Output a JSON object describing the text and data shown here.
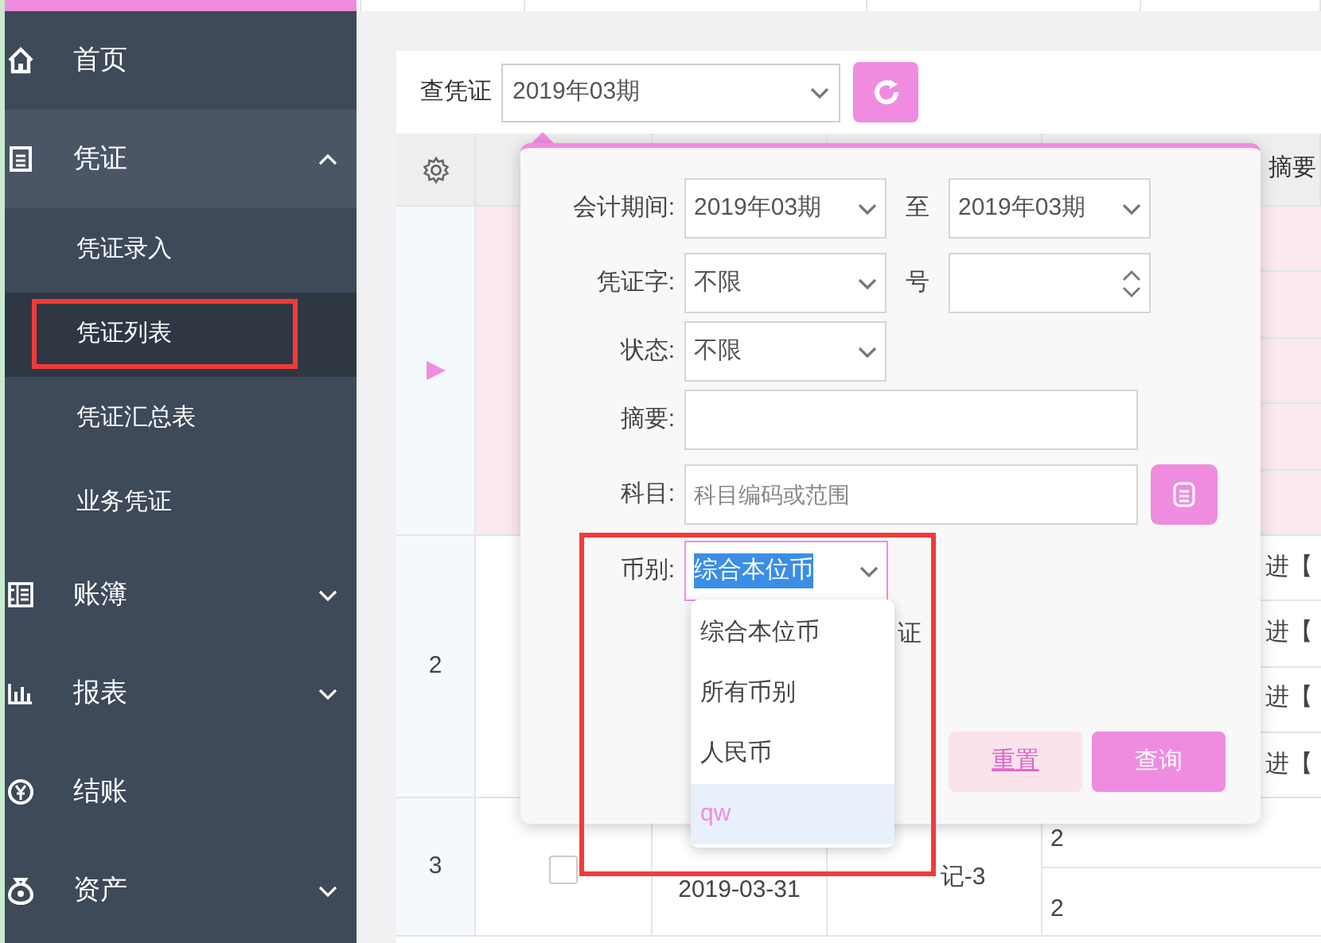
{
  "sidebar": {
    "items": [
      {
        "label": "首页",
        "kind": "link"
      },
      {
        "label": "凭证",
        "kind": "group",
        "expanded": true,
        "children": [
          {
            "label": "凭证录入",
            "selected": false
          },
          {
            "label": "凭证列表",
            "selected": true
          },
          {
            "label": "凭证汇总表",
            "selected": false
          },
          {
            "label": "业务凭证",
            "selected": false
          }
        ]
      },
      {
        "label": "账簿",
        "kind": "group",
        "expanded": false
      },
      {
        "label": "报表",
        "kind": "group",
        "expanded": false
      },
      {
        "label": "结账",
        "kind": "link"
      },
      {
        "label": "资产",
        "kind": "group",
        "expanded": false
      }
    ]
  },
  "toolbar": {
    "label": "查凭证",
    "period": "2019年03期"
  },
  "table": {
    "columns": [
      {
        "kind": "settings"
      },
      {
        "kind": "blank"
      },
      {
        "kind": "blank"
      },
      {
        "kind": "blank"
      },
      {
        "kind": "text",
        "label": "摘要"
      }
    ],
    "rows": [
      {
        "current": true
      },
      {
        "current": false,
        "number": "2",
        "summaries": [
          "进【",
          "进【",
          "进【",
          "进【"
        ]
      },
      {
        "current": false,
        "number": "3",
        "checked": false,
        "date": "2019-03-31",
        "voucher": "记-3",
        "summaries": [
          "2",
          "2"
        ]
      }
    ]
  },
  "filter": {
    "period": {
      "label": "会计期间:",
      "from": "2019年03期",
      "separator": "至",
      "to": "2019年03期"
    },
    "voucher_word": {
      "label": "凭证字:",
      "value": "不限",
      "number_label": "号"
    },
    "status": {
      "label": "状态:",
      "value": "不限"
    },
    "summary": {
      "label": "摘要:"
    },
    "account": {
      "label": "科目:",
      "placeholder": "科目编码或范围"
    },
    "currency": {
      "label": "币别:",
      "value": "综合本位币",
      "open": true,
      "options": [
        {
          "label": "综合本位币",
          "highlighted": false
        },
        {
          "label": "所有币别",
          "highlighted": false
        },
        {
          "label": "人民币",
          "highlighted": false
        },
        {
          "label": "qw",
          "highlighted": true
        }
      ]
    },
    "partial_text": "证",
    "buttons": [
      {
        "label": "重置",
        "kind": "secondary"
      },
      {
        "label": "查询",
        "kind": "primary"
      }
    ]
  }
}
